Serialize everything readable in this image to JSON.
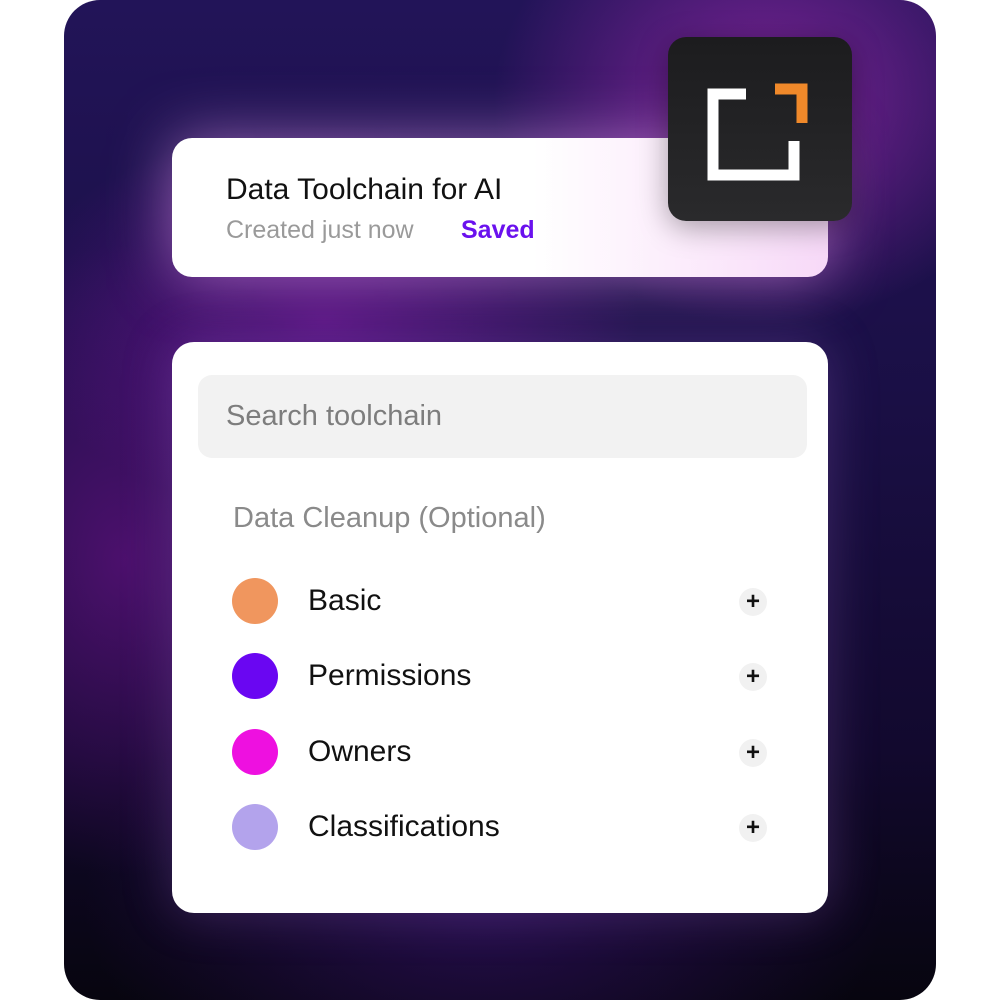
{
  "header": {
    "title": "Data Toolchain for AI",
    "created": "Created just now",
    "status": "Saved",
    "status_color": "#6a11ee"
  },
  "app_icon": {
    "name": "bracket-logo-icon",
    "accent_color": "#f0892a"
  },
  "search": {
    "placeholder": "Search toolchain",
    "value": ""
  },
  "section": {
    "title": "Data Cleanup (Optional)"
  },
  "tools": [
    {
      "label": "Basic",
      "color": "#f0965e",
      "add_icon": "plus-icon"
    },
    {
      "label": "Permissions",
      "color": "#6a06f2",
      "add_icon": "plus-icon"
    },
    {
      "label": "Owners",
      "color": "#ee10e0",
      "add_icon": "plus-icon"
    },
    {
      "label": "Classifications",
      "color": "#b3a3ec",
      "add_icon": "plus-icon"
    }
  ]
}
